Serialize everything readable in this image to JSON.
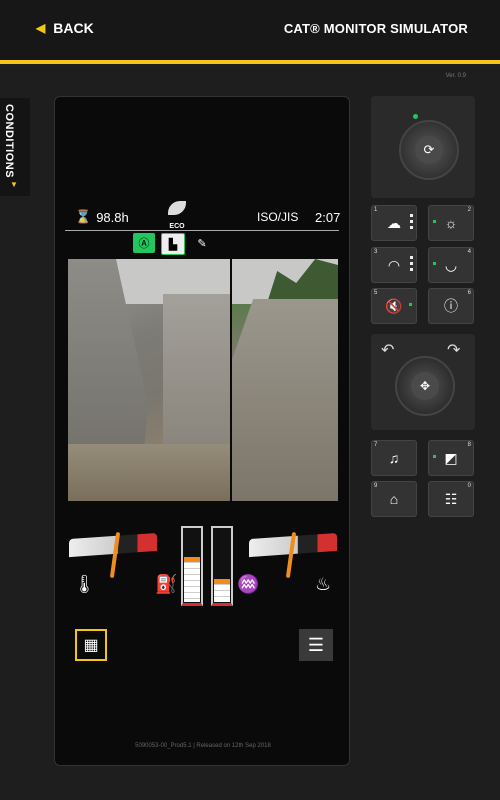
{
  "header": {
    "back_label": "BACK",
    "title": "CAT® MONITOR SIMULATOR"
  },
  "version": "Ver. 0.9",
  "conditions_tab": "CONDITIONS",
  "monitor": {
    "status": {
      "hours": "98.8h",
      "eco": "ECO",
      "standard": "ISO/JIS",
      "time": "2:07"
    },
    "footer": "5090053-00_Prod5.1 | Released on 12th Sep 2018",
    "levels": {
      "left_gauge": 0.5,
      "right_gauge": 0.5,
      "fuel_tank": 0.6,
      "def_tank": 0.3
    }
  },
  "controls": {
    "buttons": [
      {
        "num": "1",
        "icon": "lights-bar-icon"
      },
      {
        "num": "2",
        "icon": "work-light-icon"
      },
      {
        "num": "3",
        "icon": "wiper-icon"
      },
      {
        "num": "4",
        "icon": "washer-icon"
      },
      {
        "num": "5",
        "icon": "mute-icon"
      },
      {
        "num": "6",
        "icon": "info-icon"
      },
      {
        "num": "7",
        "icon": "music-icon"
      },
      {
        "num": "8",
        "icon": "brightness-icon"
      },
      {
        "num": "9",
        "icon": "home-icon"
      },
      {
        "num": "0",
        "icon": "list-icon"
      }
    ]
  },
  "colors": {
    "accent": "#f5c518",
    "active_green": "#22c55e",
    "warning_red": "#d43030",
    "needle": "#f08c1a"
  }
}
